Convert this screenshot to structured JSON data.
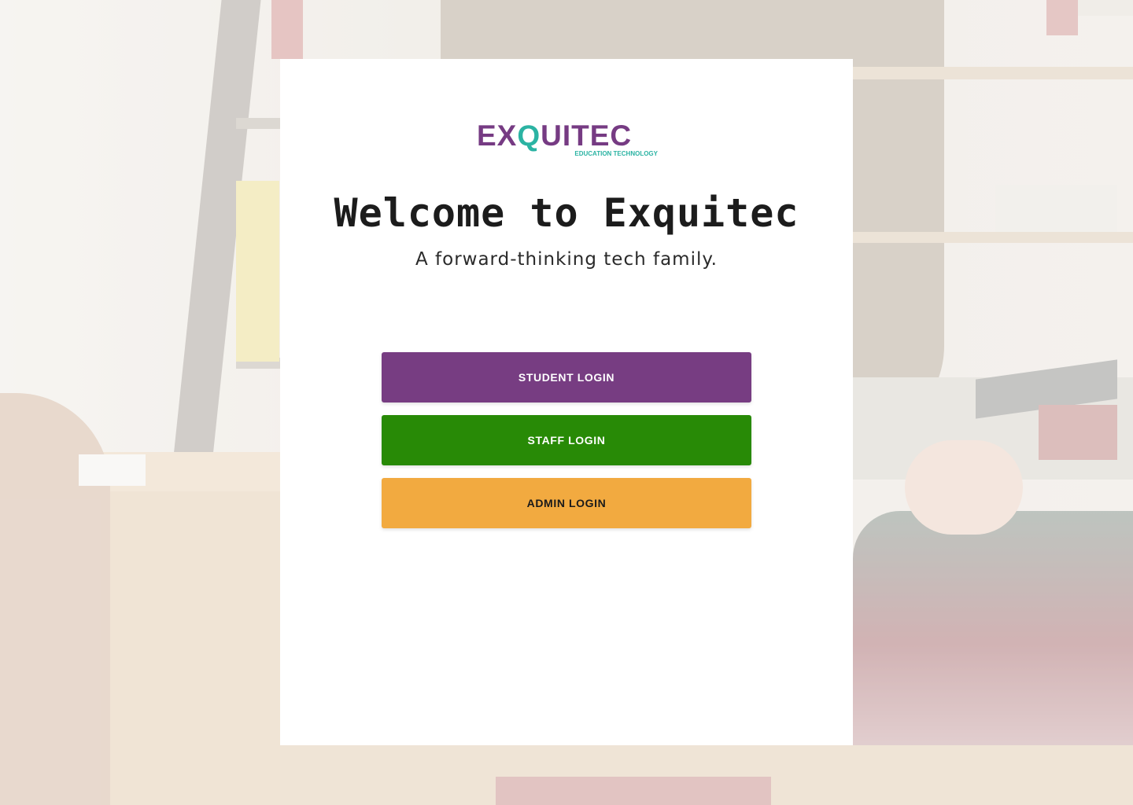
{
  "logo": {
    "wordmark_prefix": "EX",
    "wordmark_q": "Q",
    "wordmark_suffix": "UITEC",
    "tagline": "EDUCATION TECHNOLOGY"
  },
  "hero": {
    "title": "Welcome to Exquitec",
    "subtitle": "A forward-thinking tech family."
  },
  "buttons": {
    "student_label": "STUDENT LOGIN",
    "staff_label": "STAFF LOGIN",
    "admin_label": "ADMIN LOGIN"
  },
  "colors": {
    "brand_purple": "#773d82",
    "brand_teal": "#2bb3a3",
    "staff_green": "#288a06",
    "admin_orange": "#f2aa40",
    "card_background": "#ffffff"
  }
}
